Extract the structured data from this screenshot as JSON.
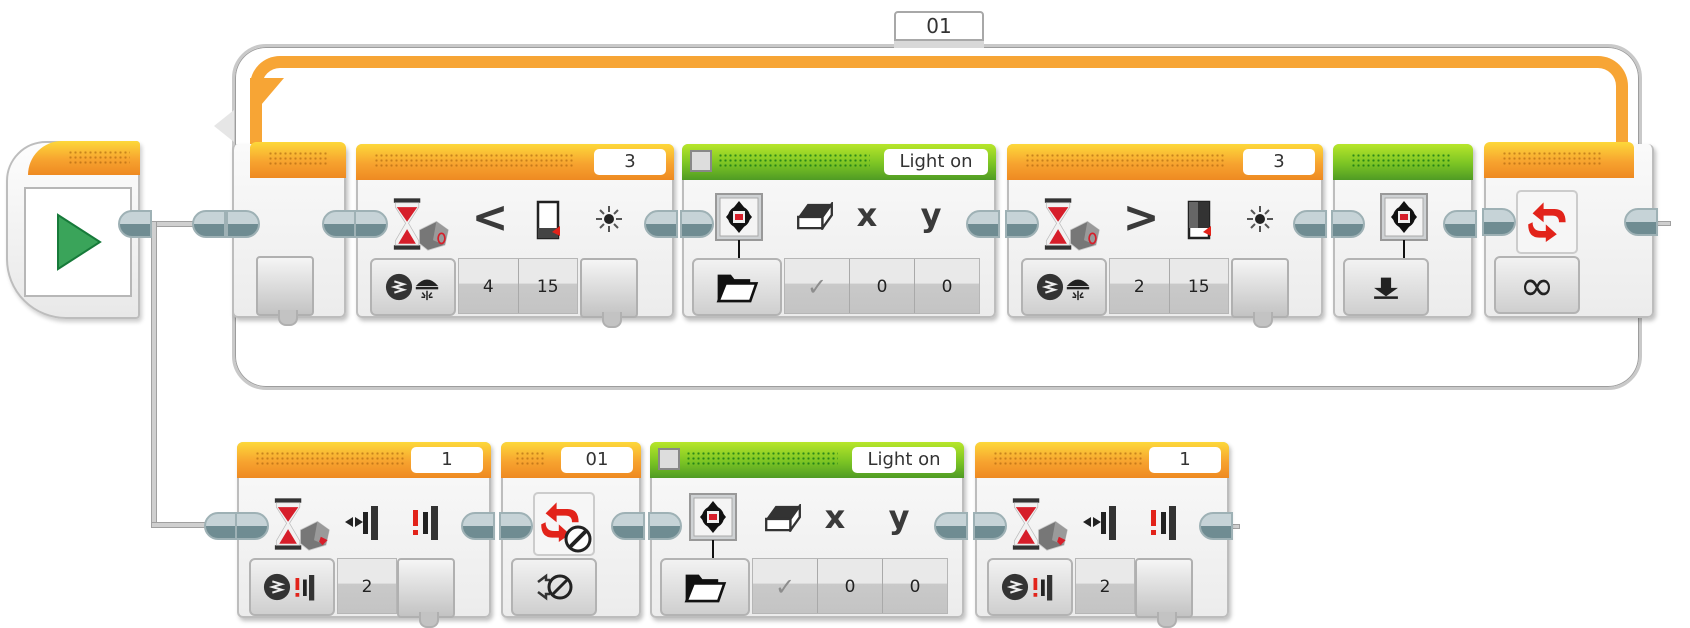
{
  "program": {
    "start": {
      "icon": "play-icon"
    },
    "loop": {
      "label": "01",
      "blocks": [
        {
          "type": "loop-start"
        },
        {
          "type": "wait",
          "sensor_port": "3",
          "mode": "color-sensor-compare-reflected-light",
          "compare_symbol": "<",
          "params": [
            "4",
            "15"
          ],
          "icons": [
            "hourglass-sensor-icon",
            "less-than-icon",
            "reflected-low-icon",
            "light-icon"
          ],
          "mode_icons": [
            "compare-icon",
            "reflected-light-icon"
          ]
        },
        {
          "type": "display",
          "label": "Light on",
          "params": [
            "✓",
            "0",
            "0"
          ],
          "icons": [
            "display-image-icon",
            "eraser-icon",
            "x-icon",
            "y-icon"
          ],
          "mode_icon": "folder-icon"
        },
        {
          "type": "wait",
          "sensor_port": "3",
          "mode": "color-sensor-compare-reflected-light",
          "compare_symbol": ">",
          "params": [
            "2",
            "15"
          ],
          "icons": [
            "hourglass-sensor-icon",
            "greater-than-icon",
            "reflected-high-icon",
            "light-icon"
          ],
          "mode_icons": [
            "compare-icon",
            "reflected-light-icon"
          ]
        },
        {
          "type": "display-reset",
          "icons": [
            "display-icon"
          ],
          "mode_icon": "reset-icon"
        },
        {
          "type": "loop-end",
          "icons": [
            "loop-icon"
          ],
          "mode_symbol": "∞"
        }
      ]
    },
    "branch2": {
      "blocks": [
        {
          "type": "wait",
          "sensor_port": "1",
          "mode": "touch-sensor-compare-state",
          "params": [
            "2"
          ],
          "icons": [
            "hourglass-touch-icon",
            "bumped-icon",
            "pressed-icon"
          ],
          "mode_icons": [
            "compare-icon",
            "touch-icon"
          ]
        },
        {
          "type": "loop-interrupt",
          "loop_name": "01",
          "icons": [
            "loop-interrupt-icon"
          ],
          "mode_icon": "interrupt-icon"
        },
        {
          "type": "display",
          "label": "Light on",
          "params": [
            "✓",
            "0",
            "0"
          ],
          "icons": [
            "display-image-icon",
            "eraser-icon",
            "x-icon",
            "y-icon"
          ],
          "mode_icon": "folder-icon"
        },
        {
          "type": "wait",
          "sensor_port": "1",
          "mode": "touch-sensor-compare-state",
          "params": [
            "2"
          ],
          "icons": [
            "hourglass-touch-icon",
            "bumped-icon",
            "pressed-icon"
          ],
          "mode_icons": [
            "compare-icon",
            "touch-icon"
          ]
        }
      ]
    }
  },
  "colors": {
    "action": "#7bc424",
    "flow": "#f7a32f",
    "wire": "#cfcfcf",
    "connector": "#6f8c92"
  }
}
